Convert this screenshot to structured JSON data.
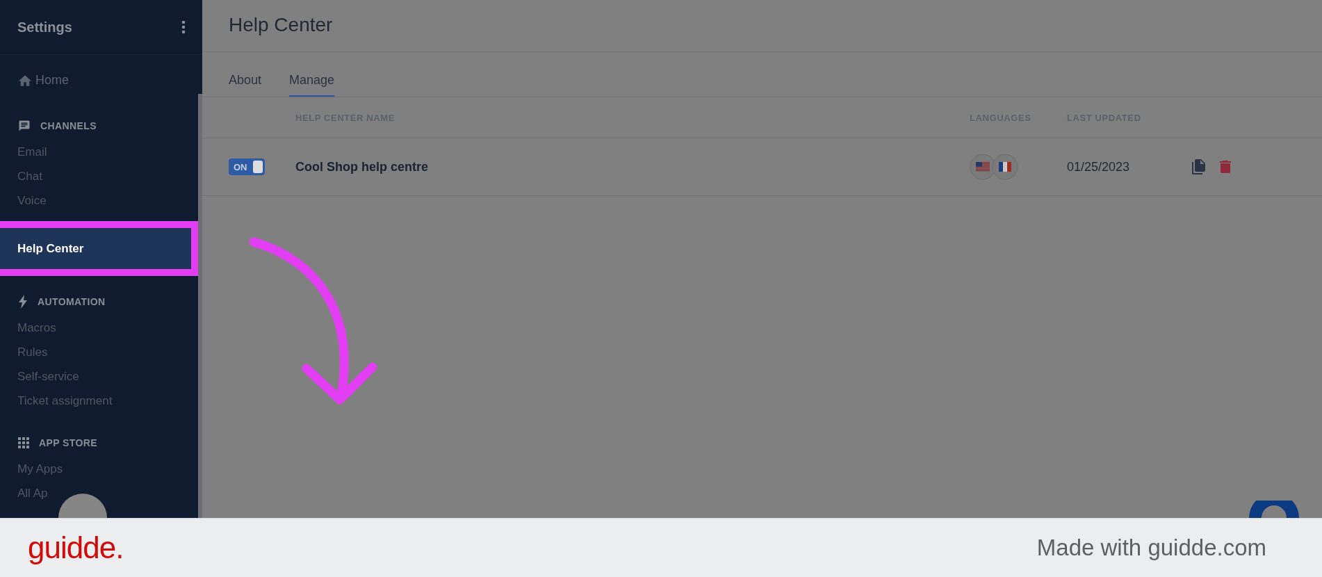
{
  "sidebar": {
    "title": "Settings",
    "home": "Home",
    "sections": [
      {
        "kind": "chat",
        "title": "CHANNELS",
        "items": [
          {
            "label": "Email",
            "selected": false
          },
          {
            "label": "Chat",
            "selected": false
          },
          {
            "label": "Voice",
            "selected": false
          },
          {
            "label": "Help Center",
            "selected": true
          }
        ]
      },
      {
        "kind": "bolt",
        "title": "AUTOMATION",
        "items": [
          {
            "label": "Macros",
            "selected": false
          },
          {
            "label": "Rules",
            "selected": false
          },
          {
            "label": "Self-service",
            "selected": false
          },
          {
            "label": "Ticket assignment",
            "selected": false
          }
        ]
      },
      {
        "kind": "grid",
        "title": "APP STORE",
        "items": [
          {
            "label": "My Apps",
            "selected": false
          },
          {
            "label": "All Ap",
            "selected": false
          }
        ]
      }
    ]
  },
  "page": {
    "title": "Help Center"
  },
  "tabs": [
    {
      "label": "About",
      "selected": false
    },
    {
      "label": "Manage",
      "selected": true
    }
  ],
  "table": {
    "columns": [
      "HELP CENTER NAME",
      "LANGUAGES",
      "LAST UPDATED"
    ],
    "rows": [
      {
        "toggle": {
          "label": "ON",
          "on": true
        },
        "name": "Cool Shop help centre",
        "languages": [
          {
            "kind": "us"
          },
          {
            "kind": "fr"
          }
        ],
        "last_updated": "01/25/2023"
      }
    ]
  },
  "banner": {
    "logo": "guidde.",
    "text": "Made with guidde.com"
  }
}
